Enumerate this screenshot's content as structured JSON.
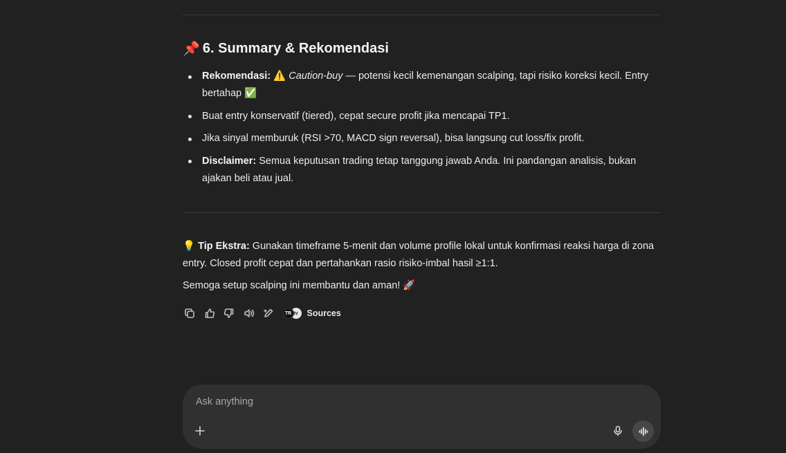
{
  "section": {
    "icon": "📌",
    "title": "6. Summary & Rekomendasi"
  },
  "bullets": [
    {
      "label": "Rekomendasi:",
      "warn_emoji": "⚠️",
      "emphasis": "Caution-buy",
      "text": " — potensi kecil kemenangan scalping, tapi risiko koreksi kecil. Entry bertahap ",
      "check_emoji": "✅"
    },
    {
      "text": "Buat entry konservatif (tiered), cepat secure profit jika mencapai TP1."
    },
    {
      "text": "Jika sinyal memburuk (RSI >70, MACD sign reversal), bisa langsung cut loss/fix profit."
    },
    {
      "label": "Disclaimer:",
      "text": " Semua keputusan trading tetap tanggung jawab Anda. Ini pandangan analisis, bukan ajakan beli atau jual."
    }
  ],
  "tip": {
    "icon": "💡",
    "label": "Tip Ekstra:",
    "text": " Gunakan timeframe 5-menit dan volume profile lokal untuk konfirmasi reaksi harga di zona entry. Closed profit cepat dan pertahankan rasio risiko-imbal hasil ≥1:1."
  },
  "closing": {
    "text": "Semoga setup scalping ini membantu dan aman! ",
    "emoji": "🚀"
  },
  "actions": {
    "icons": [
      "copy-icon",
      "thumbs-up-icon",
      "thumbs-down-icon",
      "read-aloud-icon",
      "edit-icon"
    ],
    "sources_label": "Sources",
    "source_favicons": [
      "TR",
      "tv"
    ]
  },
  "composer": {
    "placeholder": "Ask anything",
    "icons": [
      "plus-icon",
      "microphone-icon",
      "voice-mode-icon"
    ]
  }
}
